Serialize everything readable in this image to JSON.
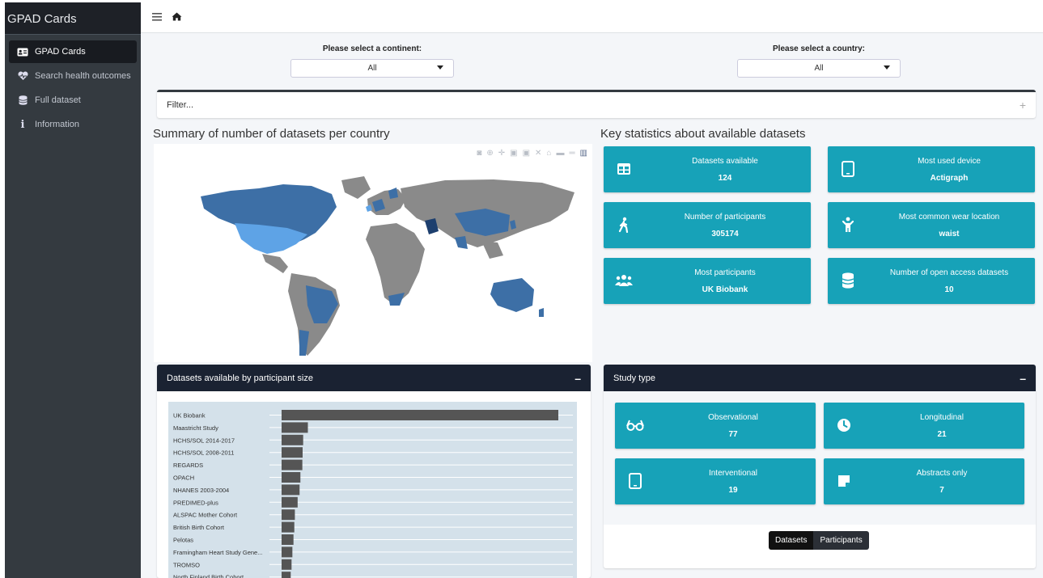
{
  "sidebar": {
    "title": "GPAD Cards",
    "items": [
      {
        "label": "GPAD Cards",
        "icon": "id-card-icon",
        "active": true
      },
      {
        "label": "Search health outcomes",
        "icon": "heart-pulse-icon",
        "active": false
      },
      {
        "label": "Full dataset",
        "icon": "database-icon",
        "active": false
      },
      {
        "label": "Information",
        "icon": "info-icon",
        "active": false
      }
    ]
  },
  "header": {
    "menu_icon": "hamburger-icon",
    "home_icon": "home-icon"
  },
  "filters": {
    "continent": {
      "label": "Please select a continent:",
      "value": "All"
    },
    "country": {
      "label": "Please select a country:",
      "value": "All"
    },
    "filter_box": {
      "label": "Filter...",
      "expand_symbol": "+"
    }
  },
  "map_section": {
    "title": "Summary of number of datasets per country"
  },
  "stats_section": {
    "title": "Key statistics about available datasets",
    "cards": [
      {
        "label": "Datasets available",
        "value": "124",
        "icon": "table-icon"
      },
      {
        "label": "Most used device",
        "value": "Actigraph",
        "icon": "tablet-icon"
      },
      {
        "label": "Number of participants",
        "value": "305174",
        "icon": "walking-icon"
      },
      {
        "label": "Most common wear location",
        "value": "waist",
        "icon": "child-icon"
      },
      {
        "label": "Most participants",
        "value": "UK Biobank",
        "icon": "users-icon"
      },
      {
        "label": "Number of open access datasets",
        "value": "10",
        "icon": "database-icon"
      }
    ]
  },
  "participants_card": {
    "title": "Datasets available by participant size",
    "minimize": "–"
  },
  "chart_data": {
    "type": "bar",
    "orientation": "horizontal",
    "categories": [
      "UK Biobank",
      "Maastricht Study",
      "HCHS/SOL 2014-2017",
      "HCHS/SOL 2008-2011",
      "REGARDS",
      "OPACH",
      "NHANES 2003-2004",
      "PREDIMED-plus",
      "ALSPAC Mother Cohort",
      "British Birth Cohort",
      "Pelotas",
      "Framingham Heart Study Gene...",
      "TROMSO",
      "North Finland Birth Cohort"
    ],
    "values": [
      100,
      9.5,
      7.8,
      7.6,
      7.5,
      6.8,
      6.5,
      5.8,
      4.8,
      4.6,
      4.3,
      3.9,
      3.6,
      3.3
    ],
    "xlabel": "",
    "ylabel": "",
    "bar_color": "#555555"
  },
  "study_type_card": {
    "title": "Study type",
    "minimize": "–",
    "cards": [
      {
        "label": "Observational",
        "value": "77",
        "icon": "glasses-icon"
      },
      {
        "label": "Longitudinal",
        "value": "21",
        "icon": "clock-icon"
      },
      {
        "label": "Interventional",
        "value": "19",
        "icon": "tablet-icon"
      },
      {
        "label": "Abstracts only",
        "value": "7",
        "icon": "note-icon"
      }
    ],
    "toggle": {
      "datasets": "Datasets",
      "participants": "Participants"
    }
  },
  "colors": {
    "accent": "#17a2b8",
    "sidebar": "#343a40",
    "card_header": "#1a2232"
  }
}
